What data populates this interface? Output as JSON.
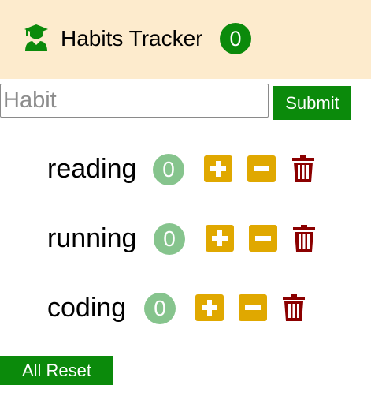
{
  "navbar": {
    "title": "Habits Tracker",
    "active_count": "0",
    "logo_icon": "graduate-user-icon",
    "background": "#fdebcd",
    "accent": "#0b8a0b"
  },
  "add_form": {
    "input_placeholder": "Habit",
    "input_value": "",
    "submit_label": "Submit"
  },
  "habits": [
    {
      "name": "reading",
      "count": "0"
    },
    {
      "name": "running",
      "count": "0"
    },
    {
      "name": "coding",
      "count": "0"
    }
  ],
  "icons": {
    "increase": "plus-square-icon",
    "decrease": "minus-square-icon",
    "delete": "trash-icon"
  },
  "colors": {
    "count_badge": "#86c48d",
    "control_button": "#e0a800",
    "delete_icon": "#8b0000"
  },
  "reset_label": "All Reset"
}
